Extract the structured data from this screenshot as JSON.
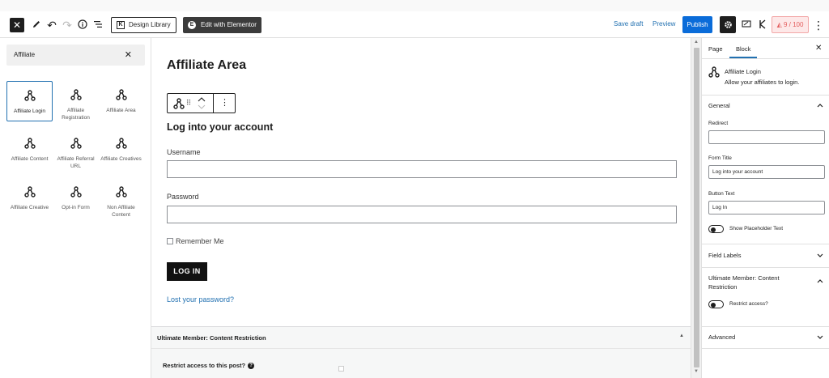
{
  "toolbar": {
    "design_library_label": "Design Library",
    "edit_elementor_label": "Edit with Elementor",
    "save_draft_label": "Save draft",
    "preview_label": "Preview",
    "publish_label": "Publish",
    "seo_score": "9 / 100"
  },
  "inserter": {
    "search_value": "Affiliate",
    "blocks": [
      {
        "label": "Affiliate Login",
        "selected": true
      },
      {
        "label": "Affiliate Registration"
      },
      {
        "label": "Affiliate Area"
      },
      {
        "label": "Affiliate Content"
      },
      {
        "label": "Affiliate Referral URL"
      },
      {
        "label": "Affiliate Creatives"
      },
      {
        "label": "Affiliate Creative"
      },
      {
        "label": "Opt-in Form"
      },
      {
        "label": "Non Affiliate Content"
      }
    ]
  },
  "canvas": {
    "page_title": "Affiliate Area",
    "form_heading": "Log into your account",
    "username_label": "Username",
    "password_label": "Password",
    "remember_label": "Remember Me",
    "login_button": "LOG IN",
    "lost_password": "Lost your password?",
    "meta_box_title": "Ultimate Member: Content Restriction",
    "meta_question": "Restrict access to this post?"
  },
  "sidebar": {
    "tab_page": "Page",
    "tab_block": "Block",
    "block_name": "Affiliate Login",
    "block_description": "Allow your affiliates to login.",
    "general_section": "General",
    "redirect_label": "Redirect",
    "redirect_value": "",
    "form_title_label": "Form Title",
    "form_title_value": "Log into your account",
    "button_text_label": "Button Text",
    "button_text_value": "Log In",
    "show_placeholder_label": "Show Placeholder Text",
    "field_labels_section": "Field Labels",
    "um_section_line1": "Ultimate Member: Content",
    "um_section_line2": "Restriction",
    "restrict_access_label": "Restrict access?",
    "advanced_section": "Advanced"
  },
  "colors": {
    "accent": "#2271b1",
    "publish": "#0a6cd9",
    "dark": "#1e1e1e",
    "seo_text": "#e35d5d"
  }
}
